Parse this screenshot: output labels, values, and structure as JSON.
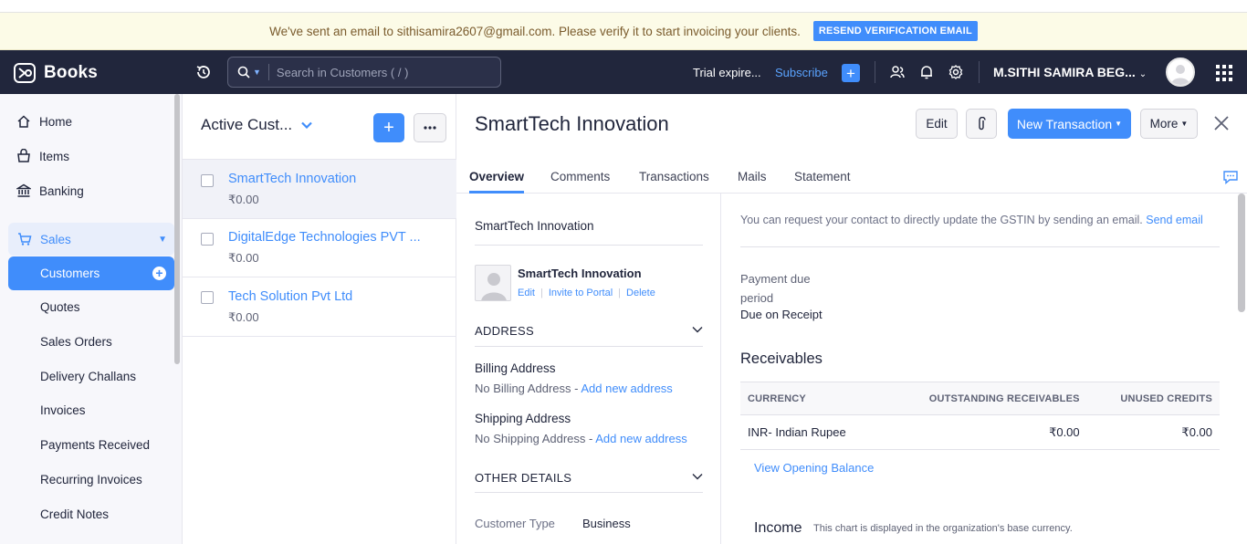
{
  "banner": {
    "message": "We've sent an email to sithisamira2607@gmail.com. Please verify it to start invoicing your clients.",
    "button": "RESEND VERIFICATION EMAIL"
  },
  "topnav": {
    "app_name": "Books",
    "search_placeholder": "Search in Customers ( / )",
    "trial": "Trial expire...",
    "subscribe": "Subscribe",
    "org_name": "M.SITHI SAMIRA BEG..."
  },
  "sidebar": {
    "home": "Home",
    "items": "Items",
    "banking": "Banking",
    "sales": "Sales",
    "customers": "Customers",
    "sub_items": [
      "Quotes",
      "Sales Orders",
      "Delivery Challans",
      "Invoices",
      "Payments Received",
      "Recurring Invoices",
      "Credit Notes"
    ]
  },
  "list": {
    "title": "Active Cust...",
    "rows": [
      {
        "name": "SmartTech Innovation",
        "amount": "₹0.00"
      },
      {
        "name": "DigitalEdge Technologies PVT ...",
        "amount": "₹0.00"
      },
      {
        "name": "Tech Solution Pvt Ltd",
        "amount": "₹0.00"
      }
    ]
  },
  "detail": {
    "title": "SmartTech Innovation",
    "edit": "Edit",
    "new_transaction": "New Transaction",
    "more": "More",
    "tabs": [
      "Overview",
      "Comments",
      "Transactions",
      "Mails",
      "Statement"
    ],
    "left": {
      "company": "SmartTech Innovation",
      "contact_name": "SmartTech Innovation",
      "links": {
        "edit": "Edit",
        "invite": "Invite to Portal",
        "delete": "Delete"
      },
      "address_head": "ADDRESS",
      "billing_label": "Billing Address",
      "billing_value": "No Billing Address -",
      "shipping_label": "Shipping Address",
      "shipping_value": "No Shipping Address -",
      "add_new_address": "Add new address",
      "other_head": "OTHER DETAILS",
      "customer_type_label": "Customer Type",
      "customer_type_value": "Business"
    },
    "right": {
      "gstin_note": "You can request your contact to directly update the GSTIN by sending an email.",
      "send_email": "Send email",
      "payment_due_label_1": "Payment due",
      "payment_due_label_2": "period",
      "payment_due_value": "Due on Receipt",
      "receivables_title": "Receivables",
      "table_headers": [
        "CURRENCY",
        "OUTSTANDING RECEIVABLES",
        "UNUSED CREDITS"
      ],
      "table_row": {
        "currency": "INR- Indian Rupee",
        "outstanding": "₹0.00",
        "unused": "₹0.00"
      },
      "view_opening_balance": "View Opening Balance",
      "income_title": "Income",
      "income_note": "This chart is displayed in the organization's base currency."
    }
  },
  "colors": {
    "accent": "#408dfb",
    "nav_bg": "#21263c",
    "banner_bg": "#fcfbe7"
  }
}
